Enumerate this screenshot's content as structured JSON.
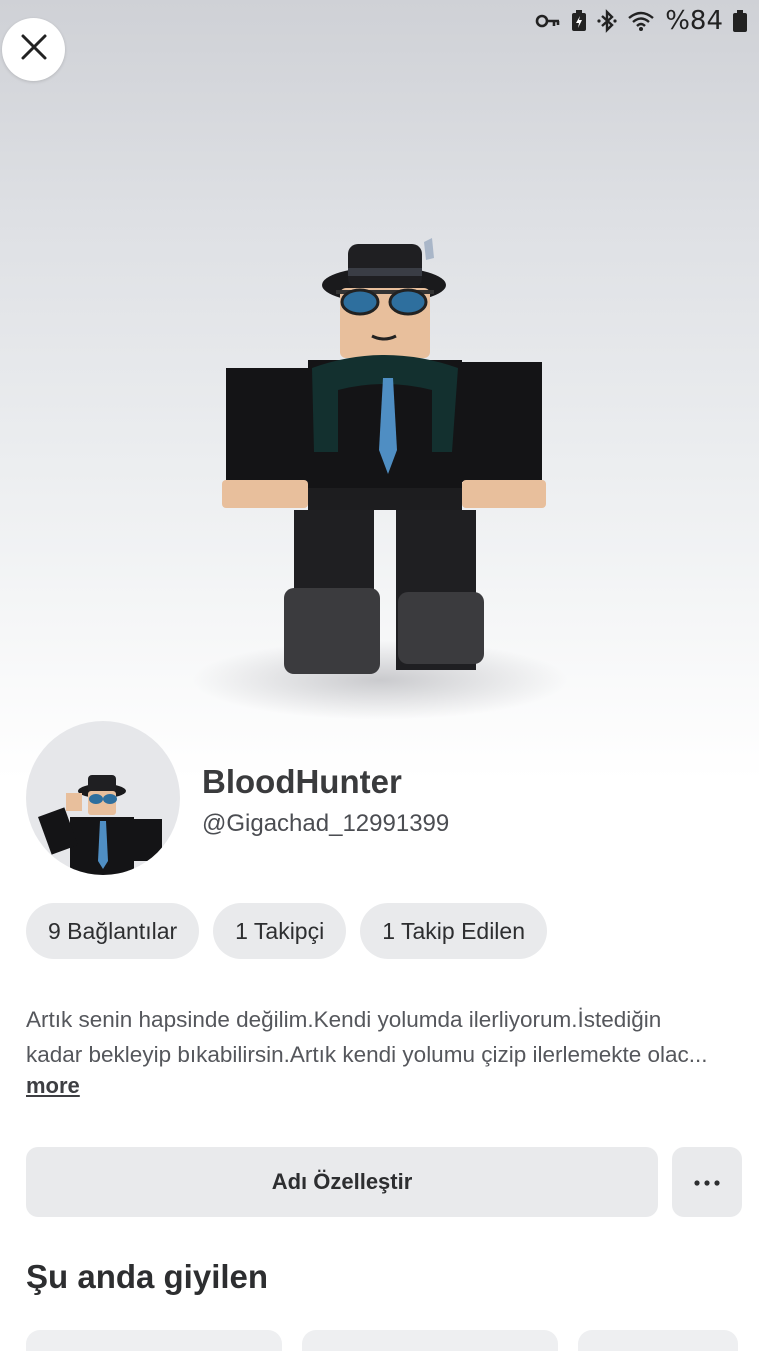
{
  "status_bar": {
    "icons": [
      "key-icon",
      "battery-saver-icon",
      "bluetooth-icon",
      "wifi-icon",
      "battery-icon"
    ],
    "battery_text": "%84"
  },
  "profile": {
    "display_name": "BloodHunter",
    "username": "@Gigachad_12991399"
  },
  "stats": {
    "connections": "9 Bağlantılar",
    "followers": "1 Takipçi",
    "following": "1 Takip Edilen"
  },
  "bio": {
    "line1": "Artık senin hapsinde değilim.Kendi yolumda ilerliyorum.İstediğin",
    "line2": "kadar bekleyip bıkabilirsin.Artık kendi yolumu çizip ilerlemekte olac...",
    "more_label": "more"
  },
  "actions": {
    "customize_label": "Adı Özelleştir",
    "more_icon": "ellipsis-icon"
  },
  "wearing": {
    "title": "Şu anda giyilen"
  },
  "colors": {
    "chip_bg": "#e9eaec",
    "text_dark": "#2d2e30"
  }
}
